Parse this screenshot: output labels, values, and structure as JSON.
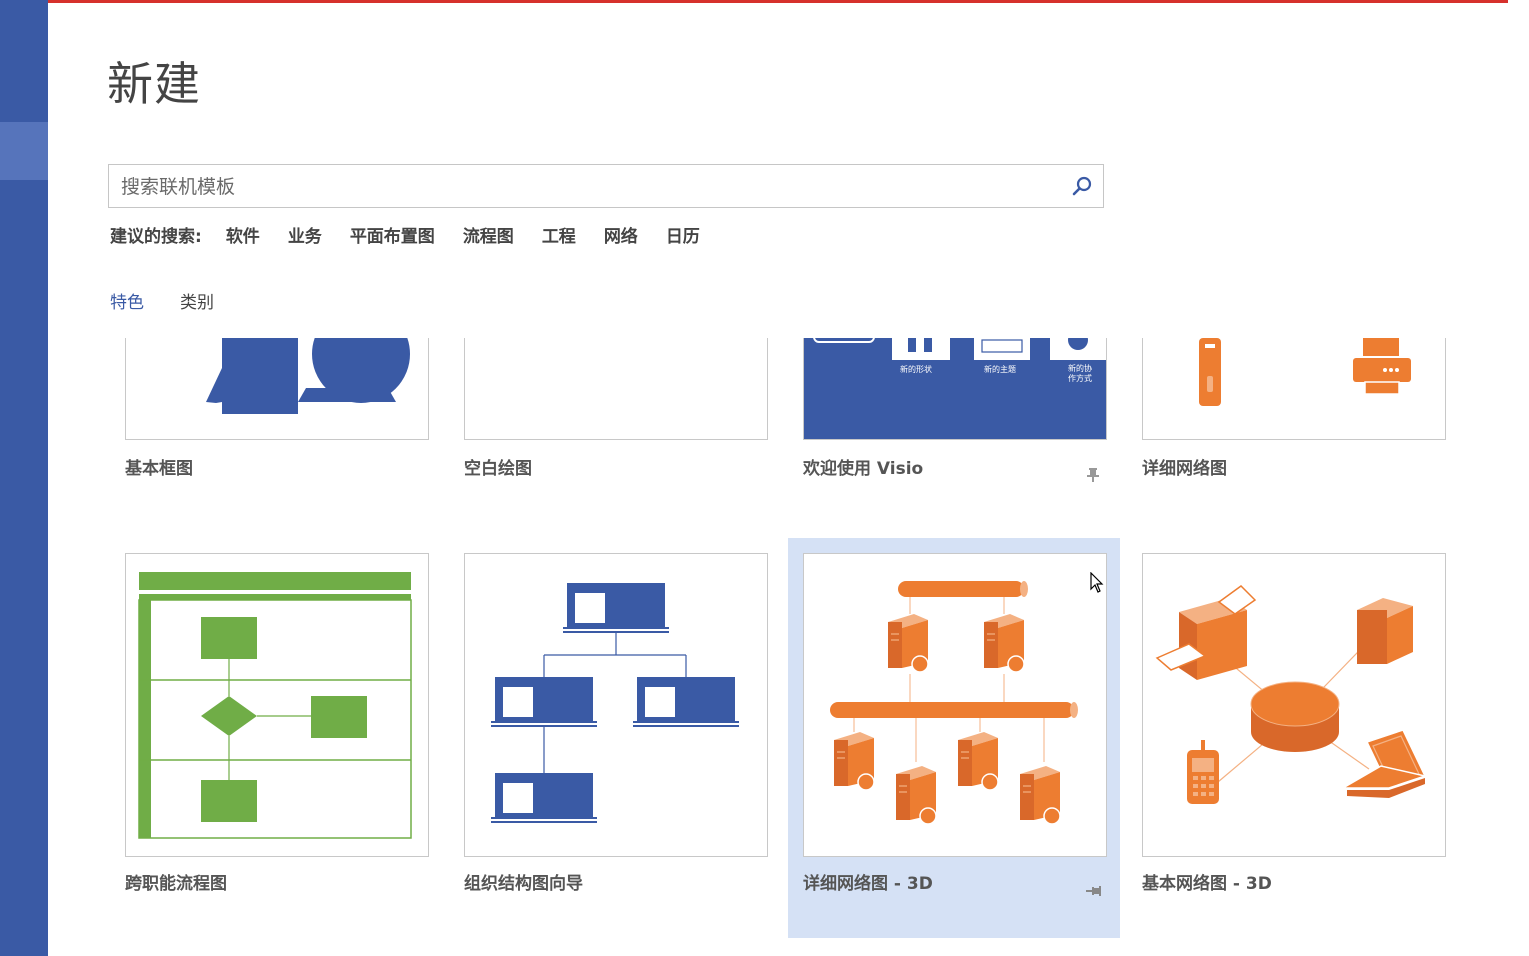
{
  "page": {
    "title": "新建"
  },
  "search": {
    "placeholder": "搜索联机模板",
    "icon": "search-icon"
  },
  "suggested": {
    "label": "建议的搜索:",
    "items": [
      "软件",
      "业务",
      "平面布置图",
      "流程图",
      "工程",
      "网络",
      "日历"
    ]
  },
  "tabs": [
    {
      "label": "特色",
      "active": true
    },
    {
      "label": "类别",
      "active": false
    }
  ],
  "templates": [
    {
      "label": "基本框图"
    },
    {
      "label": "空白绘图"
    },
    {
      "label": "欢迎使用 Visio",
      "thumb_texts": [
        "新的形状",
        "新的主题",
        "新的协作方式"
      ]
    },
    {
      "label": "详细网络图"
    },
    {
      "label": "跨职能流程图"
    },
    {
      "label": "组织结构图向导"
    },
    {
      "label": "详细网络图 - 3D",
      "selected": true
    },
    {
      "label": "基本网络图 - 3D"
    }
  ],
  "colors": {
    "accent": "#3a5aa5",
    "brand_red": "#d6312c",
    "network_orange": "#ed7d31",
    "flow_green": "#70ad47",
    "selection": "#d5e1f5"
  }
}
